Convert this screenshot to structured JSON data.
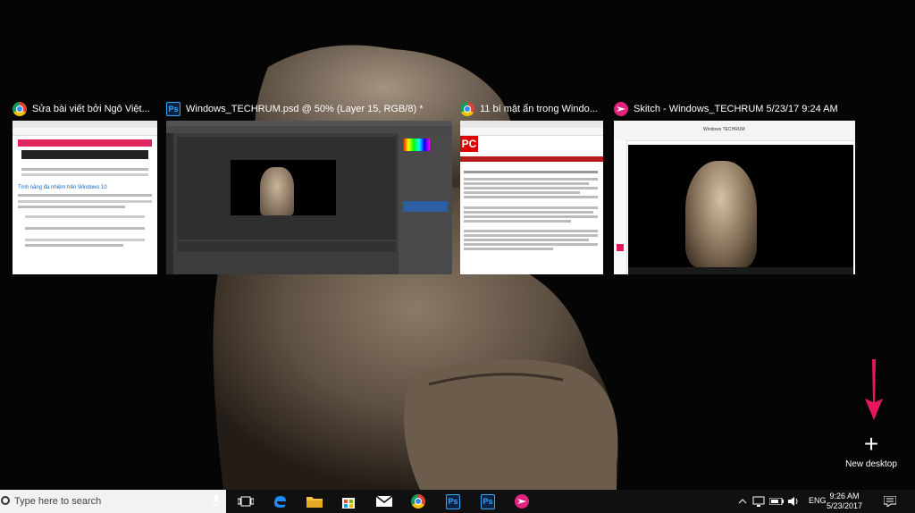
{
  "windows": [
    {
      "title": "Sửa bài viết bởi Ngô Việt...",
      "app_icon": "chrome-icon"
    },
    {
      "title": "Windows_TECHRUM.psd @ 50% (Layer 15, RGB/8) *",
      "app_icon": "photoshop-icon"
    },
    {
      "title": "11 bí mật ẩn trong Windo...",
      "app_icon": "chrome-icon"
    },
    {
      "title": "Skitch - Windows_TECHRUM 5/23/17 9:24 AM",
      "app_icon": "skitch-icon"
    }
  ],
  "thumb_text": {
    "chrome1_heading": "Tính năng đa nhiệm trên Windows 10",
    "chrome2_logo": "PC",
    "skitch_toolbar_label": "Windows TECHRUM"
  },
  "new_desktop": {
    "label": "New desktop"
  },
  "taskbar": {
    "search_placeholder": "Type here to search",
    "apps": [
      "cortana-mic-icon",
      "task-view-icon",
      "edge-icon",
      "file-explorer-icon",
      "store-icon",
      "mail-icon",
      "chrome-icon",
      "photoshop-icon",
      "photoshop-icon",
      "skitch-icon"
    ],
    "ps_label": "Ps",
    "tray": {
      "language": "ENG",
      "time": "9:26 AM",
      "date": "5/23/2017"
    }
  },
  "colors": {
    "accent_arrow": "#e8175d",
    "taskbar": "#101010",
    "search_bg": "#f2f2f2"
  }
}
